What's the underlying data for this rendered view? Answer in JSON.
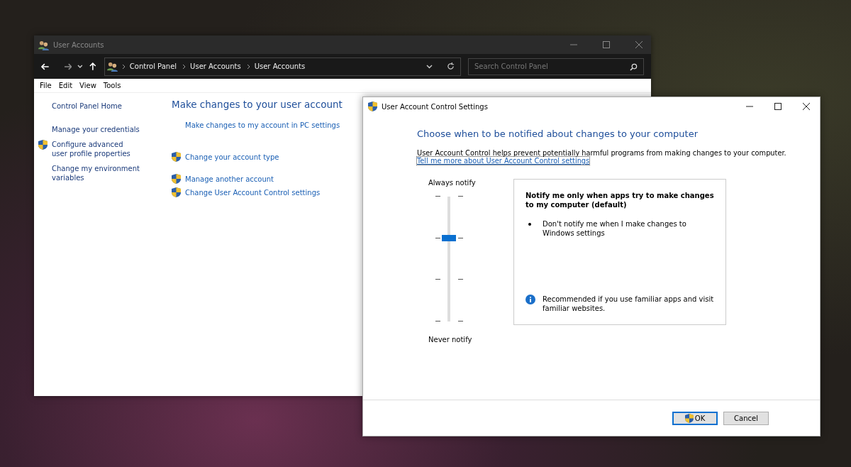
{
  "main_window": {
    "title": "User Accounts",
    "breadcrumb": [
      "Control Panel",
      "User Accounts",
      "User Accounts"
    ],
    "search": {
      "placeholder": "Search Control Panel"
    },
    "menu": [
      "File",
      "Edit",
      "View",
      "Tools"
    ],
    "sidebar": [
      {
        "label": "Control Panel Home",
        "kind": "plain"
      },
      {
        "label": "Manage your credentials",
        "kind": "plain"
      },
      {
        "label": "Configure advanced user profile properties",
        "kind": "shield"
      },
      {
        "label": "Change my environment variables",
        "kind": "plain"
      }
    ],
    "heading": "Make changes to your user account",
    "link_groups": [
      [
        {
          "label": "Make changes to my account in PC settings",
          "kind": "plain"
        }
      ],
      [
        {
          "label": "Change your account type",
          "kind": "shield"
        }
      ],
      [
        {
          "label": "Manage another account",
          "kind": "shield"
        },
        {
          "label": "Change User Account Control settings",
          "kind": "shield"
        }
      ]
    ]
  },
  "dialog": {
    "title": "User Account Control Settings",
    "heading": "Choose when to be notified about changes to your computer",
    "description": "User Account Control helps prevent potentially harmful programs from making changes to your computer.",
    "help_link": "Tell me more about User Account Control settings",
    "slider": {
      "top_label": "Always notify",
      "bottom_label": "Never notify",
      "level": 0.6667
    },
    "info": {
      "title": "Notify me only when apps try to make changes to my computer (default)",
      "bullets": [
        "Don't notify me when I make changes to Windows settings"
      ],
      "note": "Recommended if you use familiar apps and visit familiar websites."
    },
    "buttons": [
      {
        "label": "OK",
        "default": true,
        "shield": true
      },
      {
        "label": "Cancel",
        "default": false,
        "shield": false
      }
    ]
  }
}
